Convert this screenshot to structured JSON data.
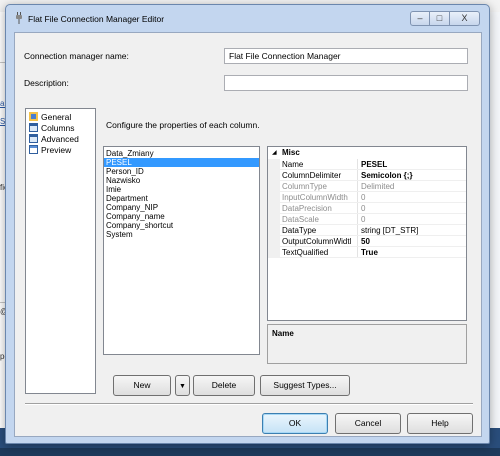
{
  "background": {
    "left_texts": [
      {
        "text": "a@",
        "link": true
      },
      {
        "text": "Se",
        "link": true
      },
      {
        "text": "fie",
        "link": false
      },
      {
        "text": "@",
        "link": false
      },
      {
        "text": "pos",
        "link": false
      }
    ]
  },
  "dialog": {
    "title": "Flat File Connection Manager Editor",
    "connection_manager_name_label": "Connection manager name:",
    "connection_manager_name_value": "Flat File Connection Manager",
    "description_label": "Description:",
    "description_value": "",
    "instruction": "Configure the properties of each column.",
    "nav": [
      {
        "label": "General",
        "icon": "general-icon"
      },
      {
        "label": "Columns",
        "icon": "columns-icon"
      },
      {
        "label": "Advanced",
        "icon": "advanced-icon"
      },
      {
        "label": "Preview",
        "icon": "preview-icon"
      }
    ],
    "columns": [
      "Data_Zmiany",
      "PESEL",
      "Person_ID",
      "Nazwisko",
      "Imie",
      "Department",
      "Company_NIP",
      "Company_name",
      "Company_shortcut",
      "System"
    ],
    "selected_column": "PESEL",
    "property_category": "Misc",
    "properties": [
      {
        "name": "Name",
        "value": "PESEL",
        "disabled": false,
        "bold": true
      },
      {
        "name": "ColumnDelimiter",
        "value": "Semicolon {;}",
        "disabled": false,
        "bold": true
      },
      {
        "name": "ColumnType",
        "value": "Delimited",
        "disabled": true,
        "bold": false
      },
      {
        "name": "InputColumnWidth",
        "value": "0",
        "disabled": true,
        "bold": false
      },
      {
        "name": "DataPrecision",
        "value": "0",
        "disabled": true,
        "bold": false
      },
      {
        "name": "DataScale",
        "value": "0",
        "disabled": true,
        "bold": false
      },
      {
        "name": "DataType",
        "value": "string [DT_STR]",
        "disabled": false,
        "bold": false
      },
      {
        "name": "OutputColumnWidtl",
        "value": "50",
        "disabled": false,
        "bold": true
      },
      {
        "name": "TextQualified",
        "value": "True",
        "disabled": false,
        "bold": true
      }
    ],
    "description_panel_title": "Name",
    "buttons": {
      "new": "New",
      "dropdown": "▼",
      "delete": "Delete",
      "suggest_types": "Suggest Types...",
      "ok": "OK",
      "cancel": "Cancel",
      "help": "Help"
    },
    "window_controls": {
      "minimize": "–",
      "maximize": "□",
      "close": "X"
    }
  }
}
